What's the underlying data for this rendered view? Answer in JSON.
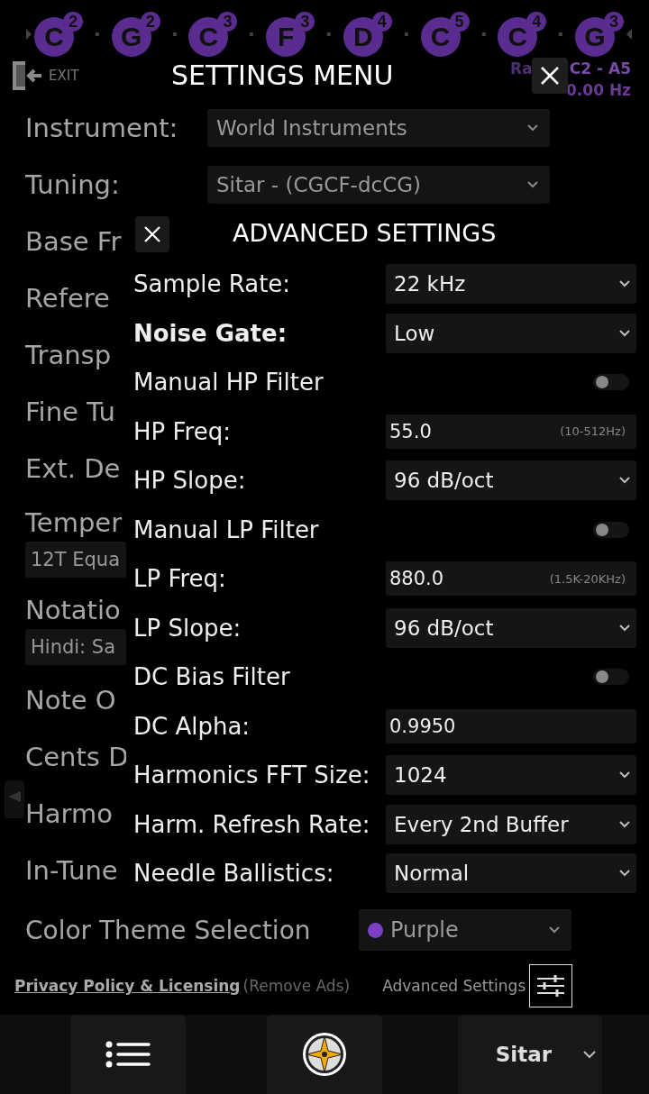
{
  "notes": [
    {
      "name": "C",
      "octave": "2"
    },
    {
      "name": "G",
      "octave": "2"
    },
    {
      "name": "C",
      "octave": "3"
    },
    {
      "name": "F",
      "octave": "3"
    },
    {
      "name": "D",
      "octave": "4"
    },
    {
      "name": "C",
      "octave": "5"
    },
    {
      "name": "C",
      "octave": "4"
    },
    {
      "name": "G",
      "octave": "3"
    }
  ],
  "header": {
    "exit_label": "EXIT",
    "title": "SETTINGS MENU",
    "range_label": "Ra",
    "range": "C2 - A5",
    "frequency": "0.00 Hz"
  },
  "settings": [
    {
      "kind": "select",
      "label": "Instrument:",
      "value": "World Instruments"
    },
    {
      "kind": "select",
      "label": "Tuning:",
      "value": "Sitar - (CGCF-dcCG)"
    },
    {
      "kind": "label",
      "label": "Base Fr"
    },
    {
      "kind": "label",
      "label": "Refere"
    },
    {
      "kind": "label",
      "label": "Transp"
    },
    {
      "kind": "label",
      "label": "Fine Tu"
    },
    {
      "kind": "label",
      "label": "Ext. De"
    },
    {
      "kind": "stacked",
      "label": "Temper",
      "value": "12T Equa"
    },
    {
      "kind": "stacked",
      "label": "Notatio",
      "value": "Hindi: Sa"
    },
    {
      "kind": "label",
      "label": "Note O"
    },
    {
      "kind": "label",
      "label": "Cents D"
    },
    {
      "kind": "label",
      "label": "Harmo"
    },
    {
      "kind": "label",
      "label": "In-Tune"
    }
  ],
  "color_theme": {
    "label": "Color Theme Selection",
    "value": "Purple",
    "color": "#7b3fc4"
  },
  "footer": {
    "link": "Privacy Policy & Licensing",
    "note": "(Remove Ads)",
    "advanced_label": "Advanced Settings"
  },
  "advanced": {
    "title": "ADVANCED SETTINGS",
    "rows": [
      {
        "kind": "select",
        "label": "Sample Rate:",
        "value": "22 kHz",
        "emphasized": false
      },
      {
        "kind": "select",
        "label": "Noise Gate:",
        "value": "Low",
        "emphasized": true
      },
      {
        "kind": "toggle",
        "label": "Manual HP Filter",
        "on": false,
        "emphasized": false
      },
      {
        "kind": "input",
        "label": "HP Freq:",
        "value": "55.0",
        "hint": "(10-512Hz)",
        "emphasized": false
      },
      {
        "kind": "select",
        "label": "HP Slope:",
        "value": "96 dB/oct",
        "emphasized": false
      },
      {
        "kind": "toggle",
        "label": "Manual LP Filter",
        "on": false,
        "emphasized": false
      },
      {
        "kind": "input",
        "label": "LP Freq:",
        "value": "880.0",
        "hint": "(1.5K-20KHz)",
        "emphasized": false
      },
      {
        "kind": "select",
        "label": "LP Slope:",
        "value": "96 dB/oct",
        "emphasized": false
      },
      {
        "kind": "toggle",
        "label": "DC Bias Filter",
        "on": false,
        "emphasized": false
      },
      {
        "kind": "input",
        "label": "DC Alpha:",
        "value": "0.9950",
        "emphasized": false
      },
      {
        "kind": "select",
        "label": "Harmonics FFT Size:",
        "value": "1024",
        "emphasized": false
      },
      {
        "kind": "select",
        "label": "Harm. Refresh Rate:",
        "value": "Every 2nd Buffer",
        "emphasized": false
      },
      {
        "kind": "select",
        "label": "Needle Ballistics:",
        "value": "Normal",
        "emphasized": false
      }
    ]
  },
  "bottom_bar": {
    "instrument": "Sitar"
  }
}
